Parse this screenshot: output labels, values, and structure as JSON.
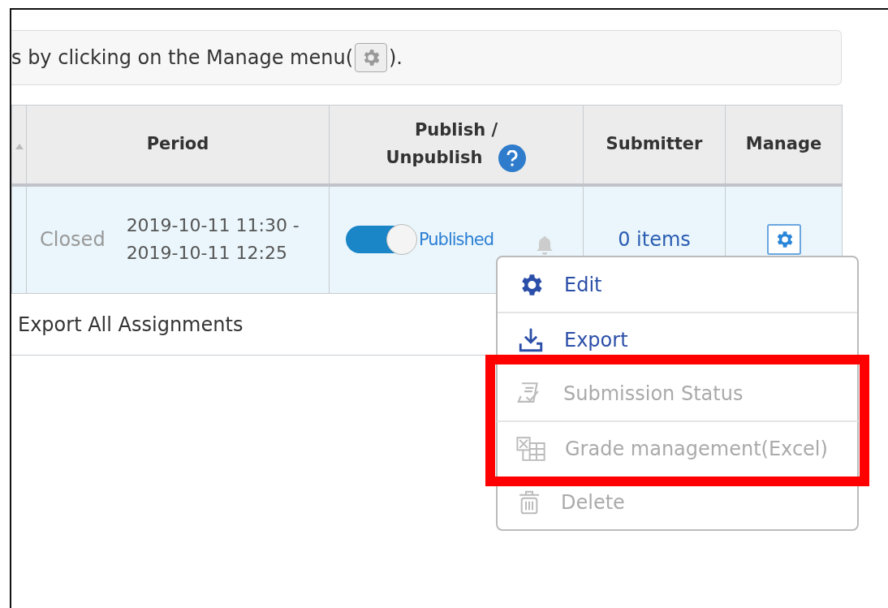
{
  "notice": {
    "before": "s by clicking on the Manage menu(",
    "after": ")."
  },
  "table": {
    "columns": [
      {},
      {
        "label": "Period"
      },
      {
        "label": "Publish /\nUnpublish"
      },
      {
        "label": "Submitter"
      },
      {
        "label": "Manage"
      }
    ],
    "rows": [
      {
        "status": "Closed",
        "period": "2019-10-11 11:30 - 2019-10-11 12:25",
        "published": true,
        "publish_label": "Published",
        "submitter": "0 items"
      }
    ]
  },
  "footer_link": "Export All Assignments",
  "menu": {
    "items": [
      {
        "label": "Edit",
        "disabled": false,
        "highlighted": false
      },
      {
        "label": "Export",
        "disabled": false,
        "highlighted": false
      },
      {
        "label": "Submission Status",
        "disabled": true,
        "highlighted": true
      },
      {
        "label": "Grade management(Excel)",
        "disabled": true,
        "highlighted": true
      },
      {
        "label": "Delete",
        "disabled": true,
        "highlighted": false
      }
    ]
  }
}
